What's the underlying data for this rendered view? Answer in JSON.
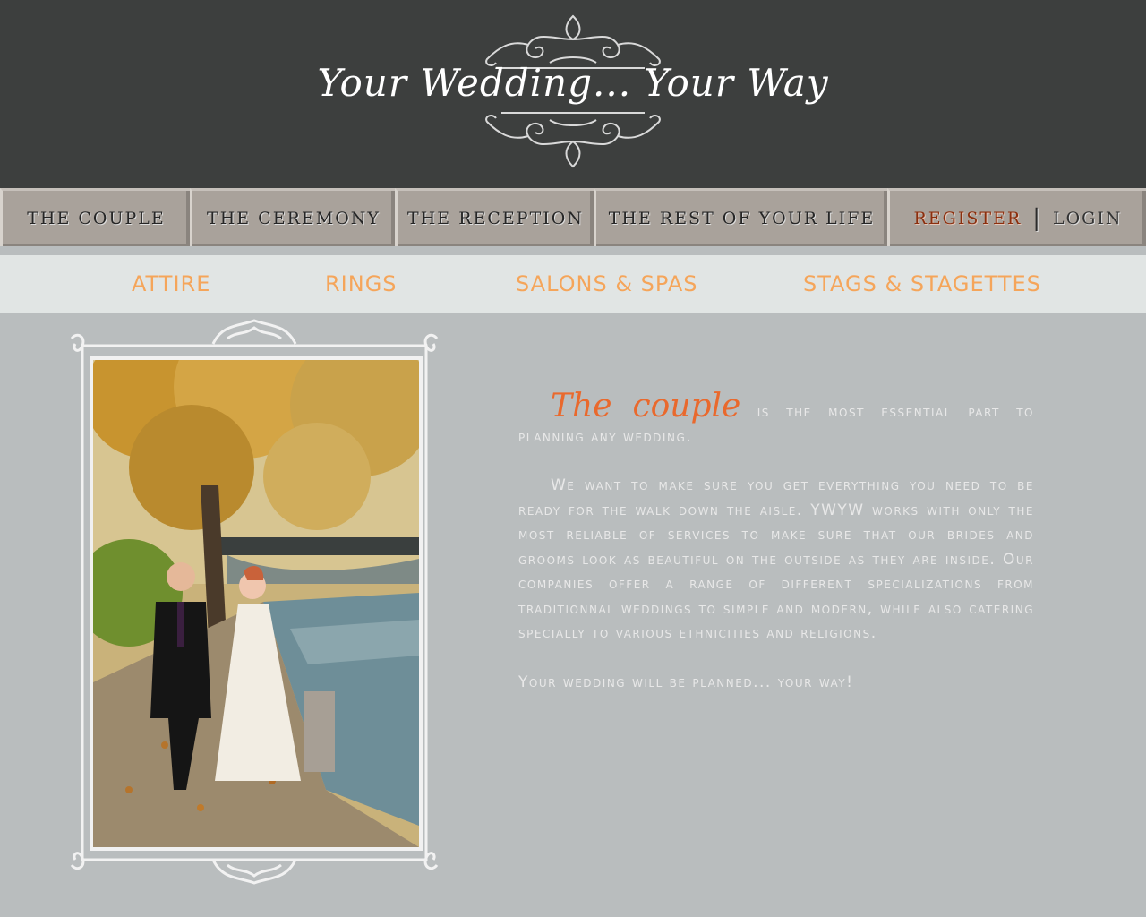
{
  "header": {
    "title": "Your Wedding... Your Way"
  },
  "nav": {
    "tabs": [
      {
        "label": "THE COUPLE"
      },
      {
        "label": "THE CEREMONY"
      },
      {
        "label": "THE RECEPTION"
      },
      {
        "label": "THE REST OF YOUR LIFE"
      }
    ],
    "register": "REGISTER",
    "separator": "|",
    "login": "LOGIN"
  },
  "subnav": {
    "items": [
      {
        "label": "ATTIRE"
      },
      {
        "label": "RINGS"
      },
      {
        "label": "SALONS & SPAS"
      },
      {
        "label": "STAGS & STAGETTES"
      }
    ]
  },
  "content": {
    "accent": "The couple",
    "intro": " is the most essential part to planning any wedding.",
    "paragraph2": "We want to make sure you get everything you need to be ready for the walk down the aisle. YWYW works with only the most reliable of services to make sure that our brides and grooms look as beautiful on the outside as they are inside. Our companies offer a range of different specializations from traditionnal weddings to simple and modern, while also catering specially to various ethnicities and religions.",
    "closing": "Your wedding will be planned... your way!"
  },
  "colors": {
    "header_bg": "#3d3f3e",
    "tab_bg": "#a9a29b",
    "subnav_bg": "#e1e5e4",
    "subnav_text": "#f5a55a",
    "body_bg": "#b9bdbe",
    "accent": "#e9692d",
    "register": "#8b2f0e"
  }
}
